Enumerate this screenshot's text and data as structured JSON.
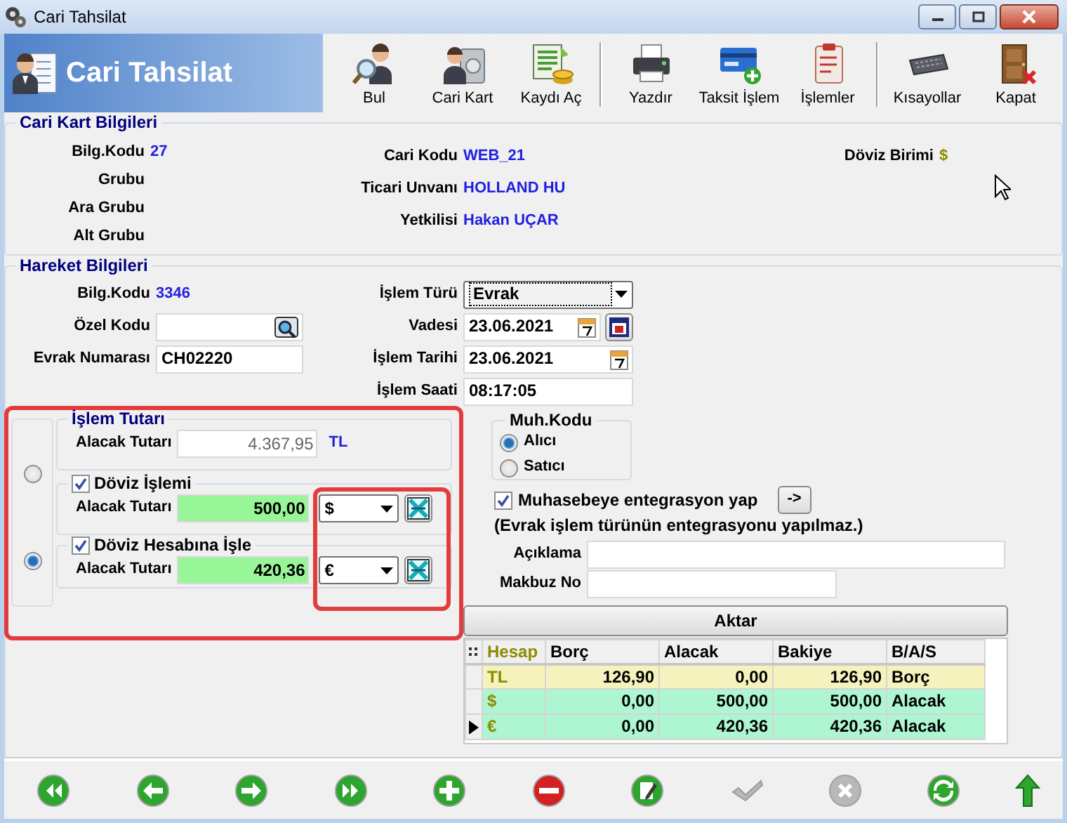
{
  "window": {
    "title": "Cari Tahsilat"
  },
  "banner": {
    "title": "Cari Tahsilat"
  },
  "toolbar_groups": [
    {
      "buttons": [
        {
          "label": "Bul",
          "kind": "search"
        },
        {
          "label": "Cari Kart",
          "kind": "card"
        },
        {
          "label": "Kaydı Aç",
          "kind": "record"
        }
      ]
    },
    {
      "buttons": [
        {
          "label": "Yazdır",
          "kind": "print"
        },
        {
          "label": "Taksit İşlem",
          "kind": "installment"
        },
        {
          "label": "İşlemler",
          "kind": "operations"
        }
      ]
    },
    {
      "buttons": [
        {
          "label": "Kısayollar",
          "kind": "keyboard"
        },
        {
          "label": "Kapat",
          "kind": "exit"
        }
      ]
    }
  ],
  "cari_kart": {
    "title": "Cari Kart Bilgileri",
    "left": [
      {
        "label": "Bilg.Kodu",
        "value": "27"
      },
      {
        "label": "Grubu"
      },
      {
        "label": "Ara Grubu"
      },
      {
        "label": "Alt Grubu"
      }
    ],
    "middle": [
      {
        "label": "Cari Kodu",
        "value": "WEB_21"
      },
      {
        "label": "Ticari Unvanı",
        "value": "HOLLAND HU"
      },
      {
        "label": "Yetkilisi",
        "value": "Hakan UÇAR"
      }
    ],
    "right": [
      {
        "label": "Döviz Birimi",
        "value": "$"
      }
    ]
  },
  "hareket": {
    "title": "Hareket Bilgileri",
    "left": [
      {
        "label": "Bilg.Kodu",
        "kind": "text",
        "value": "3346"
      },
      {
        "label": "Özel Kodu",
        "kind": "lookup"
      },
      {
        "label": "Evrak Numarası",
        "kind": "input",
        "value": "CH02220"
      }
    ],
    "middle": [
      {
        "label": "İşlem Türü",
        "kind": "dropdown",
        "value": "Evrak"
      },
      {
        "label": "Vadesi",
        "kind": "date_calendar",
        "value": "23.06.2021"
      },
      {
        "label": "İşlem Tarihi",
        "kind": "date",
        "value": "23.06.2021"
      },
      {
        "label": "İşlem Saati",
        "kind": "input",
        "value": "08:17:05"
      }
    ]
  },
  "amount_modes": [
    {
      "selected": false
    },
    {
      "selected": true
    }
  ],
  "islem_tutari": {
    "title": "İşlem Tutarı",
    "label": "Alacak Tutarı",
    "value": "4.367,95",
    "currency": "TL"
  },
  "doviz_groups": [
    {
      "title": "Döviz İşlemi",
      "checked": true,
      "label": "Alacak Tutarı",
      "value": "500,00",
      "currency": "$"
    },
    {
      "title": "Döviz Hesabına İşle",
      "checked": true,
      "label": "Alacak Tutarı",
      "value": "420,36",
      "currency": "€"
    }
  ],
  "muh_kodu": {
    "title": "Muh.Kodu",
    "options": [
      {
        "label": "Alıcı",
        "selected": true
      },
      {
        "label": "Satıcı",
        "selected": false
      }
    ]
  },
  "integration": {
    "label": "Muhasebeye entegrasyon yap",
    "checked": true,
    "button": "->",
    "note": "(Evrak işlem türünün entegrasyonu yapılmaz.)"
  },
  "aciklama": {
    "label": "Açıklama"
  },
  "makbuz_no": {
    "label": "Makbuz No"
  },
  "aktar_button": "Aktar",
  "grid": {
    "columns": [
      "Hesap",
      "Borç",
      "Alacak",
      "Bakiye",
      "B/A/S"
    ],
    "rows": [
      {
        "cells": [
          "TL",
          "126,90",
          "0,00",
          "126,90",
          "Borç"
        ],
        "color": "#f5f2bd",
        "current": false
      },
      {
        "cells": [
          "$",
          "0,00",
          "500,00",
          "500,00",
          "Alacak"
        ],
        "color": "#aef5d2",
        "current": false
      },
      {
        "cells": [
          "€",
          "0,00",
          "420,36",
          "420,36",
          "Alacak"
        ],
        "color": "#aef5d2",
        "current": true
      }
    ]
  },
  "navigation": [
    {
      "kind": "first",
      "disabled": false
    },
    {
      "kind": "previous",
      "disabled": false
    },
    {
      "kind": "next",
      "disabled": false
    },
    {
      "kind": "last",
      "disabled": false
    },
    {
      "kind": "add",
      "disabled": false
    },
    {
      "kind": "delete",
      "disabled": false
    },
    {
      "kind": "edit",
      "disabled": false
    },
    {
      "kind": "confirm",
      "disabled": true
    },
    {
      "kind": "cancel",
      "disabled": true
    },
    {
      "kind": "refresh",
      "disabled": false
    },
    {
      "kind": "up",
      "disabled": false
    }
  ]
}
